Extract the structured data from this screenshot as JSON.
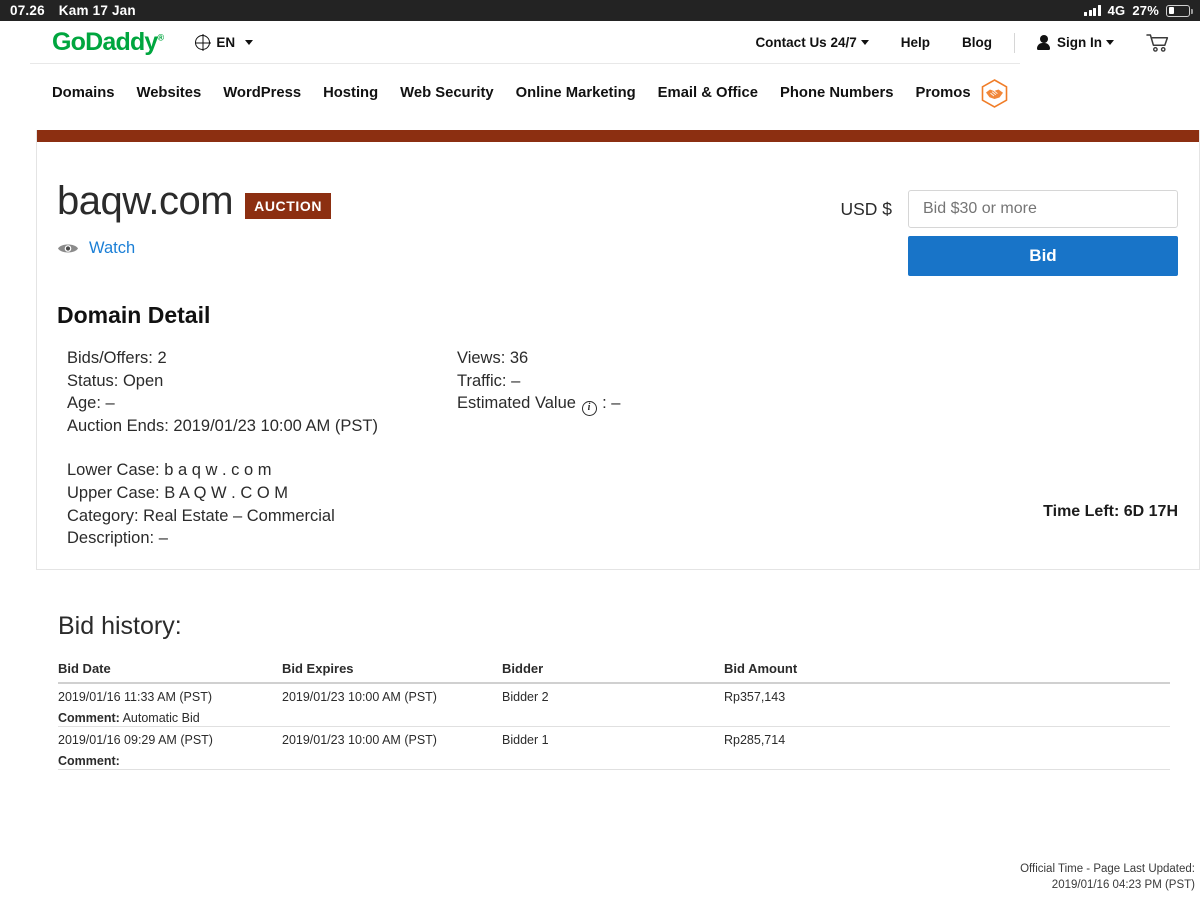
{
  "statusbar": {
    "time": "07.26",
    "date": "Kam 17 Jan",
    "network": "4G",
    "battery": "27%",
    "signal_icon": "signal-bars-icon",
    "battery_icon": "battery-icon"
  },
  "header": {
    "logo": "GoDaddy",
    "logo_sup": "®",
    "language": "EN",
    "globe_icon": "globe-icon",
    "contact": "Contact Us 24/7",
    "help": "Help",
    "blog": "Blog",
    "signin": "Sign In",
    "person_icon": "person-icon",
    "cart_icon": "shopping-cart-icon",
    "nav": [
      "Domains",
      "Websites",
      "WordPress",
      "Hosting",
      "Web Security",
      "Online Marketing",
      "Email & Office",
      "Phone Numbers"
    ],
    "promos": "Promos",
    "promos_icon": "handshake-hexagon-icon"
  },
  "auction": {
    "domain": "baqw.com",
    "badge": "AUCTION",
    "watch": "Watch",
    "watch_icon": "eye-icon",
    "currency_label": "USD $",
    "bid_placeholder": "Bid $30 or more",
    "bid_value": "",
    "bid_button": "Bid",
    "time_left": "Time Left: 6D 17H",
    "accent_color": "#8c2f11",
    "bid_button_color": "#1874c8",
    "link_color": "#1b7fd6"
  },
  "detail": {
    "heading": "Domain Detail",
    "left": [
      "Bids/Offers: 2",
      "Status: Open",
      "Age: –",
      "Auction Ends: 2019/01/23 10:00 AM (PST)"
    ],
    "right_views": "Views: 36",
    "right_traffic": "Traffic: –",
    "right_estimated_label": "Estimated Value",
    "right_estimated_value": ": –",
    "info_icon": "info-icon",
    "lower_case": "Lower Case: b a q w . c o m",
    "upper_case": "Upper Case: B A Q W . C O M",
    "category": "Category: Real Estate – Commercial",
    "description": "Description: –"
  },
  "bid_history": {
    "title": "Bid history:",
    "columns": [
      "Bid Date",
      "Bid Expires",
      "Bidder",
      "Bid Amount"
    ],
    "comment_label": "Comment:",
    "rows": [
      {
        "date": "2019/01/16 11:33 AM (PST)",
        "expires": "2019/01/23 10:00 AM (PST)",
        "bidder": "Bidder 2",
        "amount": "Rp357,143",
        "comment": " Automatic Bid"
      },
      {
        "date": "2019/01/16 09:29 AM (PST)",
        "expires": "2019/01/23 10:00 AM (PST)",
        "bidder": "Bidder 1",
        "amount": "Rp285,714",
        "comment": ""
      }
    ]
  },
  "footer": {
    "line1": "Official Time - Page Last Updated:",
    "line2": "2019/01/16 04:23 PM (PST)"
  }
}
